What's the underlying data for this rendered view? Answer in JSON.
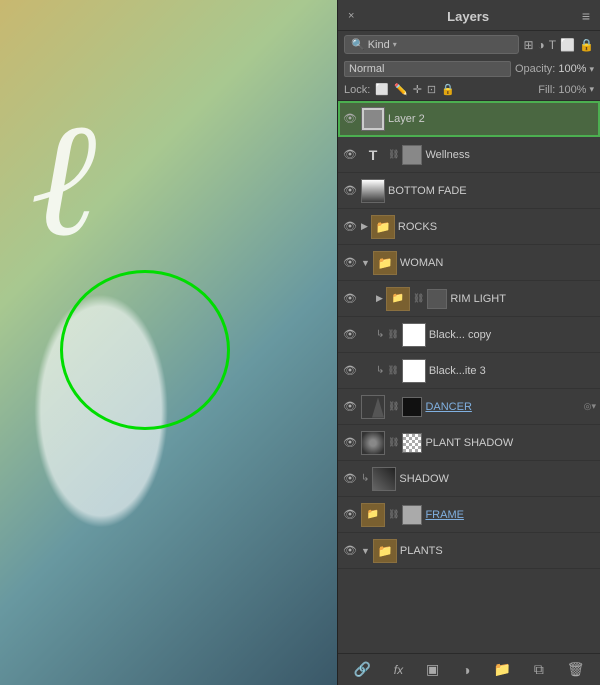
{
  "panel": {
    "title": "Layers",
    "close": "×",
    "menu": "≡",
    "search": {
      "kind_label": "Kind",
      "placeholder": "Kind"
    },
    "blend_mode": "Normal",
    "opacity_label": "Opacity:",
    "opacity_value": "100%",
    "lock_label": "Lock:",
    "fill_label": "Fill:",
    "fill_value": "100%"
  },
  "layers": [
    {
      "name": "Layer 2",
      "type": "image",
      "visible": true,
      "selected": true,
      "underline": false
    },
    {
      "name": "Wellness",
      "type": "text",
      "visible": true,
      "selected": false,
      "underline": false
    },
    {
      "name": "BOTTOM FADE",
      "type": "checker",
      "visible": true,
      "selected": false,
      "underline": false
    },
    {
      "name": "ROCKS",
      "type": "folder",
      "visible": true,
      "selected": false,
      "underline": false,
      "collapsed": true
    },
    {
      "name": "WOMAN",
      "type": "folder",
      "visible": true,
      "selected": false,
      "underline": false,
      "collapsed": false
    },
    {
      "name": "RIM LIGHT",
      "type": "folder_group",
      "visible": true,
      "selected": false,
      "underline": false,
      "indent": true,
      "collapsed": true
    },
    {
      "name": "Black... copy",
      "type": "checker_linked",
      "visible": true,
      "selected": false,
      "underline": false,
      "indent": true
    },
    {
      "name": "Black...ite 3",
      "type": "checker_linked2",
      "visible": true,
      "selected": false,
      "underline": false,
      "indent": true
    },
    {
      "name": "DANCER",
      "type": "image_effect",
      "visible": true,
      "selected": false,
      "underline": true,
      "has_effect": true
    },
    {
      "name": "PLANT SHADOW",
      "type": "image2",
      "visible": true,
      "selected": false,
      "underline": false
    },
    {
      "name": "SHADOW",
      "type": "image3",
      "visible": true,
      "selected": false,
      "underline": false
    },
    {
      "name": "FRAME",
      "type": "image4",
      "visible": true,
      "selected": false,
      "underline": true
    },
    {
      "name": "PLANTS",
      "type": "folder2",
      "visible": true,
      "selected": false,
      "underline": false,
      "collapsed": false
    }
  ],
  "footer": {
    "icons": [
      "🔗",
      "fx",
      "▣",
      "◎",
      "📁",
      "⧉",
      "🗑"
    ]
  }
}
